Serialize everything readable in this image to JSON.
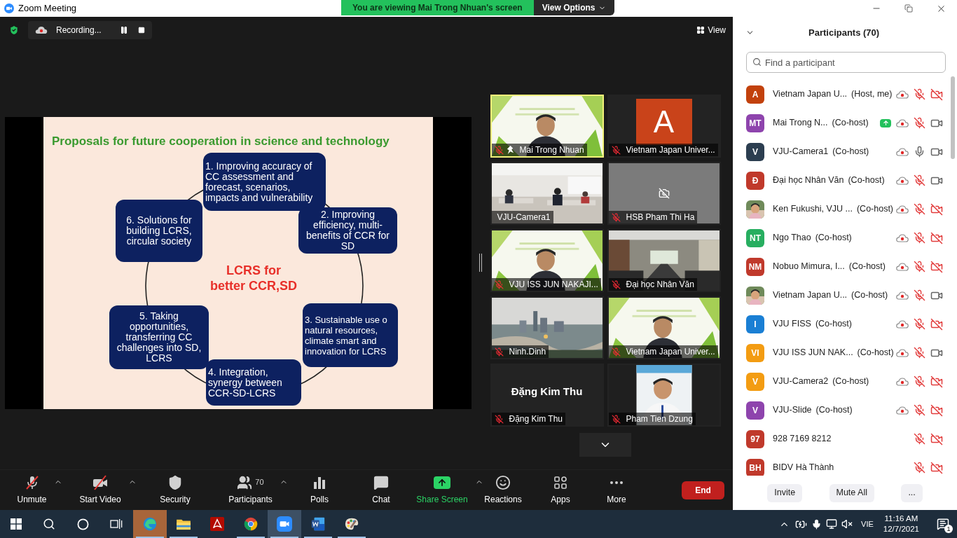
{
  "window": {
    "title": "Zoom Meeting"
  },
  "banner": {
    "text": "You are viewing Mai Trong Nhuan's screen",
    "options": "View Options"
  },
  "recording": {
    "label": "Recording..."
  },
  "view_button": "View",
  "slide": {
    "title": "Proposals for future cooperation in science and technology",
    "center": "LCRS for better CCR,SD",
    "boxes": [
      "1. Improving accuracy of CC assessment and forecast, scenarios, impacts and vulnerability",
      "6. Solutions for building  LCRS, circular society",
      "2. Improving efficiency, multi-benefits of CCR for SD",
      "5. Taking opportunities, transferring CC challenges into  SD, LCRS",
      "3. Sustainable use o natural resources, climate smart and innovation for LCRS",
      "4. Integration, synergy between CCR-SD-LCRS"
    ]
  },
  "tiles": [
    {
      "name": "Mai Trong Nhuan",
      "kind": "picture",
      "muted": true,
      "active": true,
      "pinned": true
    },
    {
      "name": "Vietnam Japan Univer...",
      "kind": "avatar",
      "avatar": "A",
      "muted": true,
      "active": false,
      "pinned": false
    },
    {
      "name": "VJU-Camera1",
      "kind": "picture",
      "muted": false,
      "active": false,
      "pinned": false
    },
    {
      "name": "HSB Pham Thi Ha",
      "kind": "camera_off",
      "muted": true,
      "active": false,
      "pinned": false
    },
    {
      "name": "VJU ISS JUN NAKAJI...",
      "kind": "picture",
      "muted": true,
      "active": false,
      "pinned": false
    },
    {
      "name": "Đại học Nhân Văn",
      "kind": "picture",
      "muted": true,
      "active": false,
      "pinned": false
    },
    {
      "name": "Ninh.Dinh",
      "kind": "picture",
      "muted": true,
      "active": false,
      "pinned": false
    },
    {
      "name": "Vietnam Japan Univer...",
      "kind": "picture",
      "muted": true,
      "active": false,
      "pinned": false
    },
    {
      "name": "Đặng Kim Thu",
      "kind": "name_only",
      "display": "Đặng Kim Thu",
      "muted": true,
      "active": false,
      "pinned": false
    },
    {
      "name": "Pham Tien Dzung",
      "kind": "picture",
      "muted": true,
      "active": false,
      "pinned": false
    }
  ],
  "participants": {
    "title": "Participants (70)",
    "search": {
      "placeholder": "Find a participant"
    },
    "rows": [
      {
        "name": "Vietnam Japan U...",
        "role": "(Host, me)",
        "avatar": {
          "kind": "initials",
          "initials": "A",
          "color": "#c2410c"
        },
        "sharing": false,
        "recording": true,
        "muted": true,
        "video_off": true
      },
      {
        "name": "Mai Trong N...",
        "role": "(Co-host)",
        "avatar": {
          "kind": "initials",
          "initials": "MT",
          "color": "#8e44ad"
        },
        "sharing": true,
        "recording": true,
        "muted": true,
        "video_off": false
      },
      {
        "name": "VJU-Camera1",
        "role": "(Co-host)",
        "avatar": {
          "kind": "initials",
          "initials": "V",
          "color": "#2c3e50"
        },
        "sharing": false,
        "recording": true,
        "muted": false,
        "video_off": false
      },
      {
        "name": "Đại học Nhân Văn",
        "role": "(Co-host)",
        "avatar": {
          "kind": "initials",
          "initials": "Đ",
          "color": "#c0392b"
        },
        "sharing": false,
        "recording": true,
        "muted": true,
        "video_off": false
      },
      {
        "name": "Ken Fukushi, VJU ...",
        "role": "(Co-host)",
        "sharing": false,
        "recording": true,
        "muted": true,
        "video_off": true
      },
      {
        "name": "Ngo Thao",
        "role": "(Co-host)",
        "avatar": {
          "kind": "initials",
          "initials": "NT",
          "color": "#27ae60"
        },
        "sharing": false,
        "recording": true,
        "muted": true,
        "video_off": true
      },
      {
        "name": "Nobuo Mimura, I...",
        "role": "(Co-host)",
        "avatar": {
          "kind": "initials",
          "initials": "NM",
          "color": "#c0392b"
        },
        "sharing": false,
        "recording": true,
        "muted": true,
        "video_off": true
      },
      {
        "name": "Vietnam Japan U...",
        "role": "(Co-host)",
        "sharing": false,
        "recording": true,
        "muted": true,
        "video_off": false
      },
      {
        "name": "VJU FISS",
        "role": "(Co-host)",
        "avatar": {
          "kind": "initials",
          "initials": "I",
          "color": "#1a7fd4"
        },
        "sharing": false,
        "recording": true,
        "muted": true,
        "video_off": true
      },
      {
        "name": "VJU ISS JUN NAK...",
        "role": "(Co-host)",
        "avatar": {
          "kind": "initials",
          "initials": "VI",
          "color": "#f39c12"
        },
        "sharing": false,
        "recording": true,
        "muted": true,
        "video_off": false
      },
      {
        "name": "VJU-Camera2",
        "role": "(Co-host)",
        "avatar": {
          "kind": "initials",
          "initials": "V",
          "color": "#f39c12"
        },
        "sharing": false,
        "recording": true,
        "muted": true,
        "video_off": true
      },
      {
        "name": "VJU-Slide",
        "role": "(Co-host)",
        "avatar": {
          "kind": "initials",
          "initials": "V",
          "color": "#8e44ad"
        },
        "sharing": false,
        "recording": true,
        "muted": true,
        "video_off": true
      },
      {
        "name": "928 7169 8212",
        "avatar": {
          "kind": "initials",
          "initials": "97",
          "color": "#c0392b"
        },
        "sharing": false,
        "recording": false,
        "muted": true,
        "video_off": true
      },
      {
        "name": "BIDV Hà Thành",
        "avatar": {
          "kind": "initials",
          "initials": "BH",
          "color": "#c0392b"
        },
        "sharing": false,
        "recording": false,
        "muted": true,
        "video_off": true
      }
    ],
    "buttons": [
      "Invite",
      "Mute All",
      "..."
    ]
  },
  "toolbar": {
    "items": [
      {
        "label": "Unmute",
        "kind": "mic",
        "off": true,
        "caret": true
      },
      {
        "label": "Start Video",
        "kind": "video",
        "off": true,
        "caret": true
      },
      {
        "label": "Security",
        "kind": "security",
        "caret": false
      },
      {
        "label": "Participants",
        "kind": "participants",
        "count": "70",
        "caret": true
      },
      {
        "label": "Polls",
        "kind": "polls",
        "caret": false
      },
      {
        "label": "Chat",
        "kind": "chat",
        "caret": false
      },
      {
        "label": "Share Screen",
        "kind": "share",
        "caret": true
      },
      {
        "label": "Reactions",
        "kind": "reactions",
        "caret": false
      },
      {
        "label": "Apps",
        "kind": "apps",
        "caret": false
      },
      {
        "label": "More",
        "kind": "more",
        "caret": false
      }
    ],
    "end": "End"
  },
  "taskbar": {
    "apps": [
      {
        "kind": "edge",
        "selected": true,
        "running": true
      },
      {
        "kind": "explorer",
        "selected": false,
        "running": true
      },
      {
        "kind": "acrobat",
        "selected": false,
        "running": false
      },
      {
        "kind": "chrome",
        "selected": false,
        "running": true
      },
      {
        "kind": "zoom",
        "selected": true,
        "running": true
      },
      {
        "kind": "word",
        "selected": false,
        "running": true
      },
      {
        "kind": "paint",
        "selected": false,
        "running": true
      }
    ],
    "language": "VIE",
    "time": "11:16 AM",
    "date": "12/7/2021",
    "notifications": "1"
  }
}
